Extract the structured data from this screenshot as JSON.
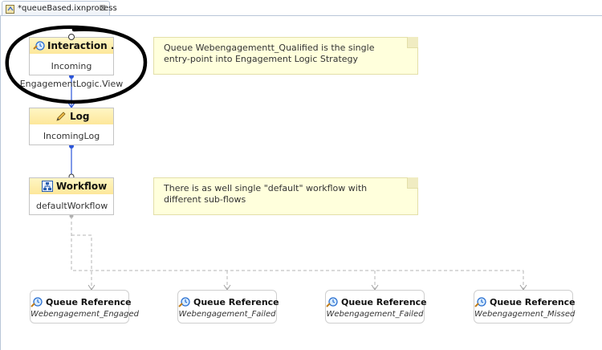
{
  "editor": {
    "tab_title": "*queueBased.ixnprocess",
    "tab_close": "⊠"
  },
  "nodes": {
    "interaction": {
      "title": "Interaction ...",
      "line1": "Incoming",
      "line2": "EngagementLogic.View"
    },
    "log": {
      "title": "Log",
      "line1": "IncomingLog"
    },
    "workflow": {
      "title": "Workflow",
      "line1": "defaultWorkflow"
    }
  },
  "notes": [
    {
      "text": "Queue Webengagementt_Qualified is the single entry-point into Engagement Logic Strategy"
    },
    {
      "text": "There is as well single \"default\" workflow with different sub-flows"
    }
  ],
  "queue_refs": [
    {
      "title": "Queue Reference",
      "name": "Webengagement_Engaged"
    },
    {
      "title": "Queue Reference",
      "name": "Webengagement_Failed"
    },
    {
      "title": "Queue Reference",
      "name": "Webengagement_Failed"
    },
    {
      "title": "Queue Reference",
      "name": "Webengagement_Missed"
    }
  ],
  "colors": {
    "header_yellow": "#fde79a",
    "note_yellow": "#ffffdc",
    "connector_blue": "#2b55d8",
    "dashed_gray": "#b5b5b5",
    "highlight_circle": "#000000"
  }
}
